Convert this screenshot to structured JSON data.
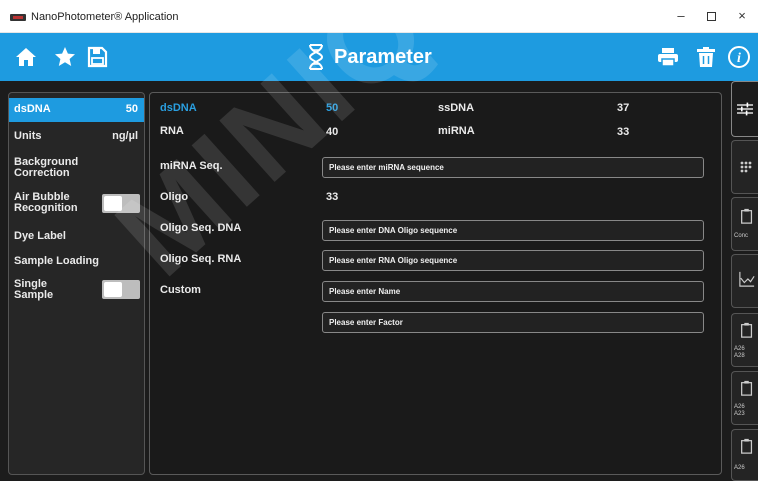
{
  "window": {
    "title": "NanoPhotometer® Application",
    "minimize": "–",
    "close": "×"
  },
  "toolbar": {
    "title": "Parameter",
    "icons": {
      "home": "home-icon",
      "favorite": "star-icon",
      "save": "save-icon",
      "title": "dna-icon",
      "print": "printer-icon",
      "delete": "trash-icon",
      "info": "info-icon"
    }
  },
  "sidebar": {
    "items": [
      {
        "label": "dsDNA",
        "value": "50"
      },
      {
        "label": "Units",
        "value": "ng/µl"
      },
      {
        "label": "Background Correction"
      },
      {
        "label": "Air Bubble Recognition",
        "toggle": "off"
      },
      {
        "label": "Dye Label"
      },
      {
        "label": "Sample Loading"
      },
      {
        "label": "Single Sample",
        "toggle": "off"
      }
    ]
  },
  "factors": {
    "dsdna_label": "dsDNA",
    "dsdna_value": "50",
    "ssdna_label": "ssDNA",
    "ssdna_value": "37",
    "rna_label": "RNA",
    "rna_value": "40",
    "mirna_label": "miRNA",
    "mirna_value": "33",
    "mirna_seq_label": "miRNA Seq.",
    "mirna_seq_placeholder": "Please enter miRNA sequence",
    "oligo_label": "Oligo",
    "oligo_value": "33",
    "oligo_dna_label": "Oligo Seq. DNA",
    "oligo_dna_placeholder": "Please enter DNA Oligo sequence",
    "oligo_rna_label": "Oligo Seq. RNA",
    "oligo_rna_placeholder": "Please enter RNA Oligo sequence",
    "custom_label": "Custom",
    "custom_name_placeholder": "Please enter Name",
    "custom_factor_placeholder": "Please enter Factor"
  },
  "rail": {
    "tabs": [
      {
        "icon": "sliders-icon",
        "text": ""
      },
      {
        "icon": "microvolume-icon",
        "text": ""
      },
      {
        "icon": "cuvette-icon",
        "text": "Conc"
      },
      {
        "icon": "spectrum-icon",
        "text": ""
      },
      {
        "icon": "cuvette-icon",
        "text": "A26 A28"
      },
      {
        "icon": "cuvette-icon",
        "text": "A26 A23"
      },
      {
        "icon": "cuvette-icon",
        "text": "A26"
      }
    ]
  },
  "watermark": "MINIQUE D",
  "colors": {
    "accent": "#1e9be0",
    "background": "#1c1c1c",
    "panel": "#1a1a1a"
  }
}
